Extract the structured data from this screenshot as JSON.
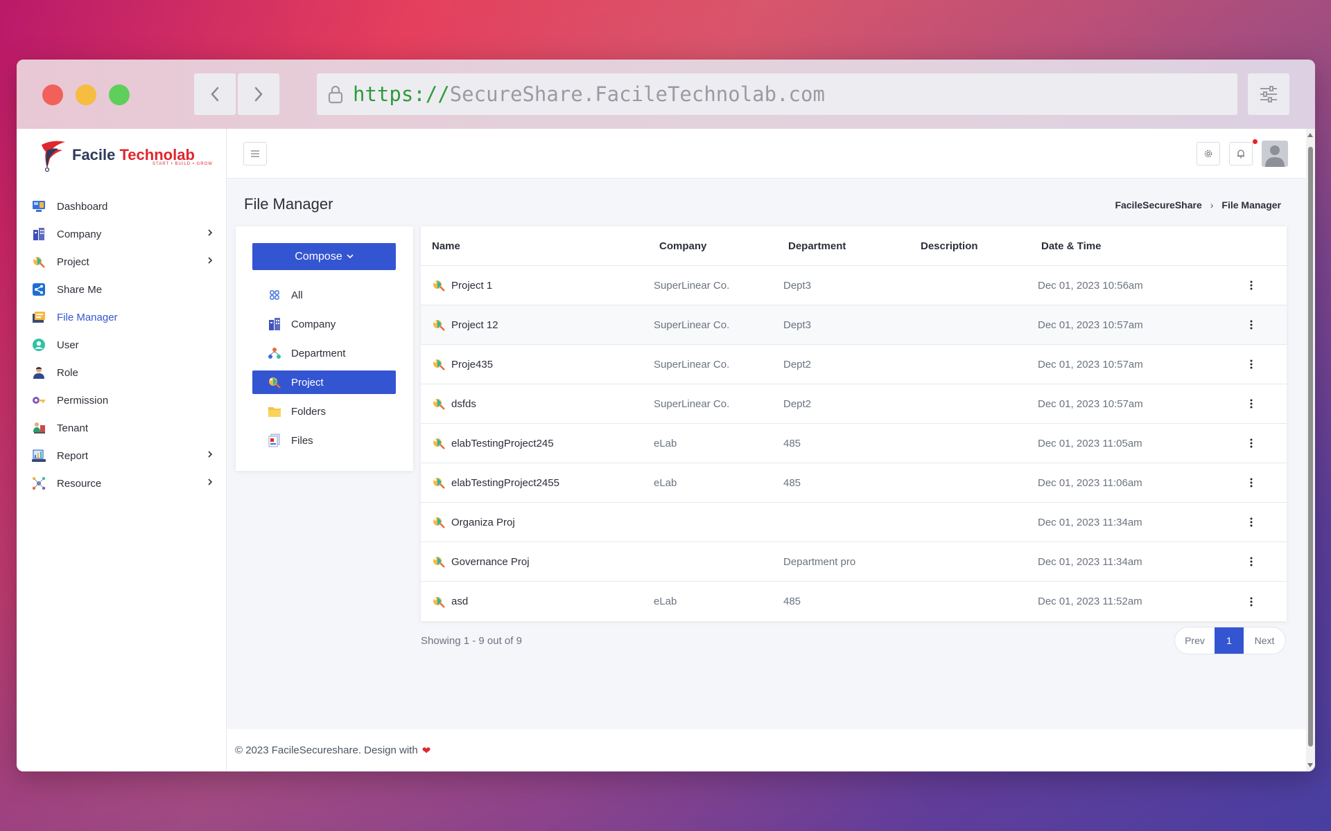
{
  "browser": {
    "url_scheme": "https://",
    "url_host": "SecureShare.FacileTechnolab.com"
  },
  "brand": {
    "name_part1": "Facile",
    "name_part2": "Technolab",
    "tagline": "START • BUILD • GROW"
  },
  "sidebar": {
    "items": [
      {
        "label": "Dashboard",
        "icon": "dashboard-icon",
        "has_submenu": false
      },
      {
        "label": "Company",
        "icon": "company-icon",
        "has_submenu": true
      },
      {
        "label": "Project",
        "icon": "project-icon",
        "has_submenu": true
      },
      {
        "label": "Share Me",
        "icon": "share-icon",
        "has_submenu": false
      },
      {
        "label": "File Manager",
        "icon": "file-manager-icon",
        "has_submenu": false,
        "active": true
      },
      {
        "label": "User",
        "icon": "user-icon",
        "has_submenu": false
      },
      {
        "label": "Role",
        "icon": "role-icon",
        "has_submenu": false
      },
      {
        "label": "Permission",
        "icon": "permission-icon",
        "has_submenu": false
      },
      {
        "label": "Tenant",
        "icon": "tenant-icon",
        "has_submenu": false
      },
      {
        "label": "Report",
        "icon": "report-icon",
        "has_submenu": true
      },
      {
        "label": "Resource",
        "icon": "resource-icon",
        "has_submenu": true
      }
    ]
  },
  "page": {
    "title": "File Manager",
    "breadcrumb": [
      "FacileSecureShare",
      "File Manager"
    ]
  },
  "file_panel": {
    "compose_label": "Compose",
    "filters": [
      {
        "label": "All",
        "icon": "grid-icon"
      },
      {
        "label": "Company",
        "icon": "company-icon"
      },
      {
        "label": "Department",
        "icon": "department-icon"
      },
      {
        "label": "Project",
        "icon": "project-icon",
        "active": true
      },
      {
        "label": "Folders",
        "icon": "folder-icon"
      },
      {
        "label": "Files",
        "icon": "files-icon"
      }
    ]
  },
  "table": {
    "columns": [
      "Name",
      "Company",
      "Department",
      "Description",
      "Date & Time"
    ],
    "rows": [
      {
        "name": "Project 1",
        "company": "SuperLinear Co.",
        "department": "Dept3",
        "description": "",
        "date": "Dec 01, 2023 10:56am"
      },
      {
        "name": "Project 12",
        "company": "SuperLinear Co.",
        "department": "Dept3",
        "description": "",
        "date": "Dec 01, 2023 10:57am"
      },
      {
        "name": "Proje435",
        "company": "SuperLinear Co.",
        "department": "Dept2",
        "description": "",
        "date": "Dec 01, 2023 10:57am"
      },
      {
        "name": "dsfds",
        "company": "SuperLinear Co.",
        "department": "Dept2",
        "description": "",
        "date": "Dec 01, 2023 10:57am"
      },
      {
        "name": "elabTestingProject245",
        "company": "eLab",
        "department": "485",
        "description": "",
        "date": "Dec 01, 2023 11:05am"
      },
      {
        "name": "elabTestingProject2455",
        "company": "eLab",
        "department": "485",
        "description": "",
        "date": "Dec 01, 2023 11:06am"
      },
      {
        "name": "Organiza Proj",
        "company": "",
        "department": "",
        "description": "",
        "date": "Dec 01, 2023 11:34am"
      },
      {
        "name": "Governance Proj",
        "company": "",
        "department": "Department pro",
        "description": "",
        "date": "Dec 01, 2023 11:34am"
      },
      {
        "name": "asd",
        "company": "eLab",
        "department": "485",
        "description": "",
        "date": "Dec 01, 2023 11:52am"
      }
    ]
  },
  "pagination": {
    "showing": "Showing 1 - 9 out of 9",
    "prev": "Prev",
    "current": "1",
    "next": "Next"
  },
  "footer": {
    "text": "© 2023 FacileSecureshare. Design with"
  },
  "colors": {
    "accent": "#3455d1",
    "brand_red": "#e0262d"
  }
}
